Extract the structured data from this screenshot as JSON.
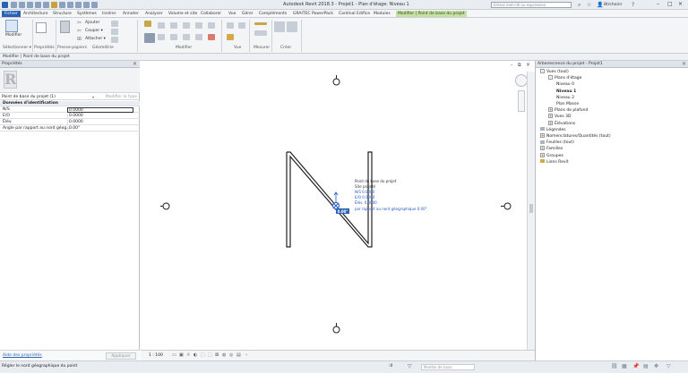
{
  "window": {
    "title": "Autodesk Revit 2018.3 - Projet1 - Plan d'étage: Niveau 1",
    "search_placeholder": "Entrez mot-clé ou expression",
    "user": "8trcheinr"
  },
  "menubar": {
    "items": [
      "Fichier",
      "Architecture",
      "Structure",
      "Systèmes",
      "Insérer",
      "Annoter",
      "Analyser",
      "Volume et site",
      "Collaborer",
      "Vue",
      "Gérer",
      "Compléments",
      "GRAITEC PowerPack",
      "Cardinal Edifice",
      "Modules",
      "Modifier | Point de base du projet"
    ]
  },
  "ribbon": {
    "modify_label": "Modifier",
    "select_label": "Sélectionner ▾",
    "properties_label": "Propriétés",
    "clipboard_label": "Presse-papiers",
    "cut_label": "Couper ▾",
    "join_label": "Attacher ▾",
    "add_label": "Ajouter",
    "geometry_label": "Géométrie",
    "modify_panel_label": "Modifier",
    "view_label": "Vue",
    "measure_label": "Mesurer",
    "create_label": "Créer"
  },
  "optionsbar": {
    "text": "Modifier | Point de base du projet"
  },
  "properties": {
    "title": "Propriétés",
    "type_selector_value": "Point de base du projet (1)",
    "edit_type_label": "Modifier le type",
    "section": "Données d'identification",
    "rows": [
      {
        "key": "N/S",
        "value": "0.0000"
      },
      {
        "key": "E/O",
        "value": "0.0000"
      },
      {
        "key": "Élév.",
        "value": "0.0000"
      },
      {
        "key": "Angle par rapport au nord géog...",
        "value": "0.00°"
      }
    ],
    "help_link": "Aide des propriétés",
    "apply_label": "Appliquer"
  },
  "canvas": {
    "annotation": {
      "title": "Point de base du projet",
      "site": "Site projeté",
      "ns": "N/S   0.0000",
      "eo": "E/O   0.0000",
      "elev": "Élév.   0.0000",
      "angle": "par rapport au nord géographique   0.00°",
      "angle_edit": "0.00°"
    }
  },
  "view_control": {
    "scale": "1 : 100"
  },
  "browser": {
    "title": "Arborescence du projet - Projet1",
    "nodes": [
      {
        "label": "Vues (tout)",
        "level": 0,
        "toggle": "-"
      },
      {
        "label": "Plans d'étage",
        "level": 1,
        "toggle": "-"
      },
      {
        "label": "Niveau 0",
        "level": 2
      },
      {
        "label": "Niveau 1",
        "level": 2,
        "bold": true
      },
      {
        "label": "Niveau 2",
        "level": 2
      },
      {
        "label": "Plan Masse",
        "level": 2
      },
      {
        "label": "Plans de plafond",
        "level": 1,
        "toggle": "+"
      },
      {
        "label": "Vues 3D",
        "level": 1,
        "toggle": "+"
      },
      {
        "label": "Élévations",
        "level": 1,
        "toggle": "+"
      },
      {
        "label": "Légendes",
        "level": 0,
        "icon": true
      },
      {
        "label": "Nomenclatures/Quantités (tout)",
        "level": 0,
        "toggle": "+"
      },
      {
        "label": "Feuilles (tout)",
        "level": 0,
        "icon": true
      },
      {
        "label": "Familles",
        "level": 0,
        "toggle": "+"
      },
      {
        "label": "Groupes",
        "level": 0,
        "toggle": "+"
      },
      {
        "label": "Liens Revit",
        "level": 0,
        "icon": true
      }
    ]
  },
  "statusbar": {
    "message": "Régler le nord géographique du point",
    "model_placeholder": "Modèle de base",
    "zero": ":0"
  },
  "colors": {
    "file_tab": "#2b63b3",
    "context_tab": "#c7e0a5",
    "selection_blue": "#2359c7"
  }
}
